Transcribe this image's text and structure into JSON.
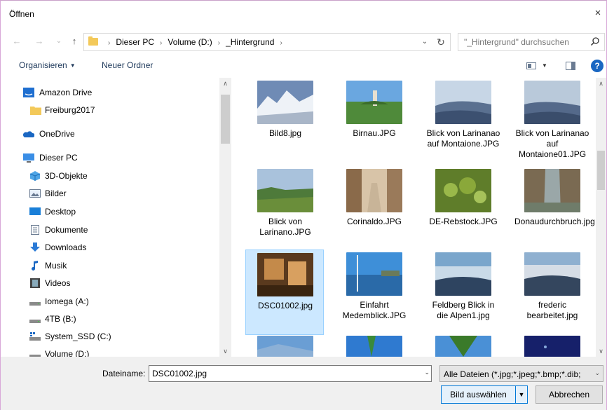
{
  "window": {
    "title": "Öffnen",
    "close_glyph": "×"
  },
  "nav": {
    "back": "←",
    "forward": "→",
    "recent": "⌄",
    "up": "↑"
  },
  "address": {
    "crumbs": [
      "Dieser PC",
      "Volume (D:)",
      "_Hintergrund"
    ],
    "sep": "›",
    "dropdown": "⌄",
    "refresh": "↻"
  },
  "search": {
    "placeholder": "\"_Hintergrund\" durchsuchen"
  },
  "toolbar": {
    "organize": "Organisieren",
    "organize_caret": "▼",
    "new_folder": "Neuer Ordner",
    "view_caret": "▼",
    "help": "?"
  },
  "sidebar": {
    "items": [
      {
        "label": "Amazon Drive",
        "icon": "amazon-drive-icon"
      },
      {
        "label": "Freiburg2017",
        "icon": "folder-icon"
      },
      {
        "label": "OneDrive",
        "icon": "onedrive-icon"
      },
      {
        "label": "Dieser PC",
        "icon": "computer-icon"
      },
      {
        "label": "3D-Objekte",
        "icon": "3d-objects-icon"
      },
      {
        "label": "Bilder",
        "icon": "pictures-icon"
      },
      {
        "label": "Desktop",
        "icon": "desktop-icon"
      },
      {
        "label": "Dokumente",
        "icon": "documents-icon"
      },
      {
        "label": "Downloads",
        "icon": "downloads-icon"
      },
      {
        "label": "Musik",
        "icon": "music-icon"
      },
      {
        "label": "Videos",
        "icon": "videos-icon"
      },
      {
        "label": "Iomega (A:)",
        "icon": "drive-icon"
      },
      {
        "label": "4TB (B:)",
        "icon": "drive-icon"
      },
      {
        "label": "System_SSD (C:)",
        "icon": "system-drive-icon"
      },
      {
        "label": "Volume (D:)",
        "icon": "drive-icon"
      }
    ]
  },
  "files": [
    {
      "name": "Bild8.jpg"
    },
    {
      "name": "Birnau.JPG"
    },
    {
      "name": "Blick von Larinanao auf Montaione.JPG"
    },
    {
      "name": "Blick von Larinanao auf Montaione01.JPG"
    },
    {
      "name": "Blick von Larinano.JPG"
    },
    {
      "name": "Corinaldo.JPG"
    },
    {
      "name": "DE-Rebstock.JPG"
    },
    {
      "name": "Donaudurchbruch.jpg"
    },
    {
      "name": "DSC01002.jpg"
    },
    {
      "name": "Einfahrt Medemblick.JPG"
    },
    {
      "name": "Feldberg Blick in die Alpen1.jpg"
    },
    {
      "name": "frederic bearbeitet.jpg"
    }
  ],
  "bottom": {
    "filename_label": "Dateiname:",
    "filename_value": "DSC01002.jpg",
    "filter": "Alle Dateien (*.jpg;*.jpeg;*.bmp;*.dib;",
    "dd": "⌄",
    "open": "Bild auswählen",
    "open_split": "▼",
    "cancel": "Abbrechen"
  },
  "scroll": {
    "up": "∧",
    "down": "∨"
  },
  "colors": {
    "accent": "#0078d7",
    "selection": "#cce8ff",
    "folder": "#f3c95a"
  }
}
